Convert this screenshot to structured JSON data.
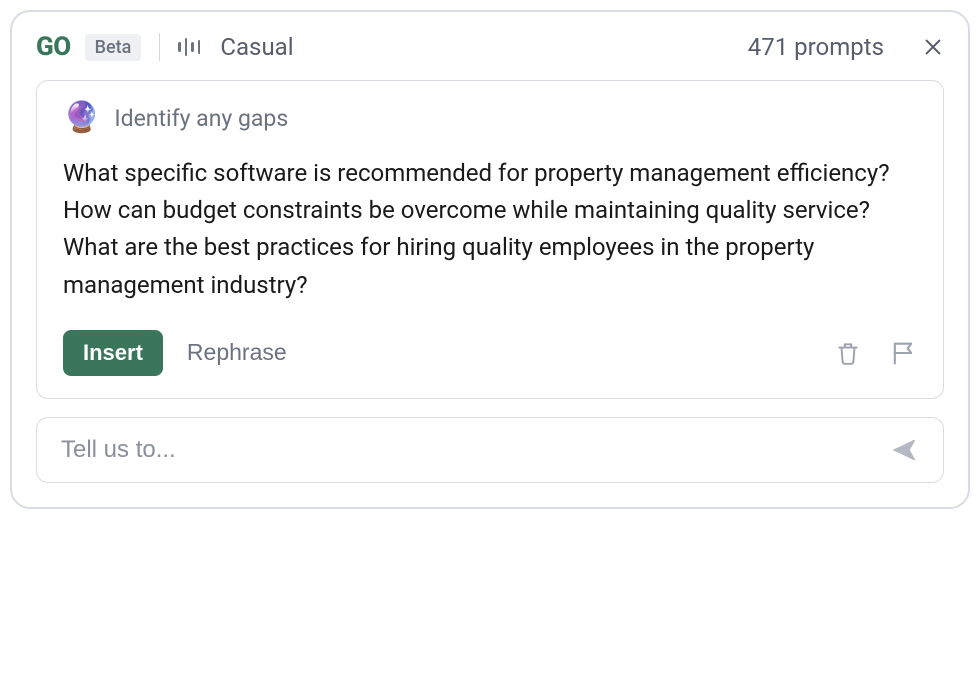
{
  "header": {
    "logo": "GO",
    "beta": "Beta",
    "tone_label": "Casual",
    "prompts_count": "471 prompts"
  },
  "card": {
    "icon": "🔮",
    "title": "Identify any gaps",
    "body": "What specific software is recommended for property management efficiency?\nHow can budget constraints be overcome while maintaining quality service?\nWhat are the best practices for hiring quality employees in the property management industry?",
    "insert_label": "Insert",
    "rephrase_label": "Rephrase"
  },
  "input": {
    "placeholder": "Tell us to..."
  }
}
